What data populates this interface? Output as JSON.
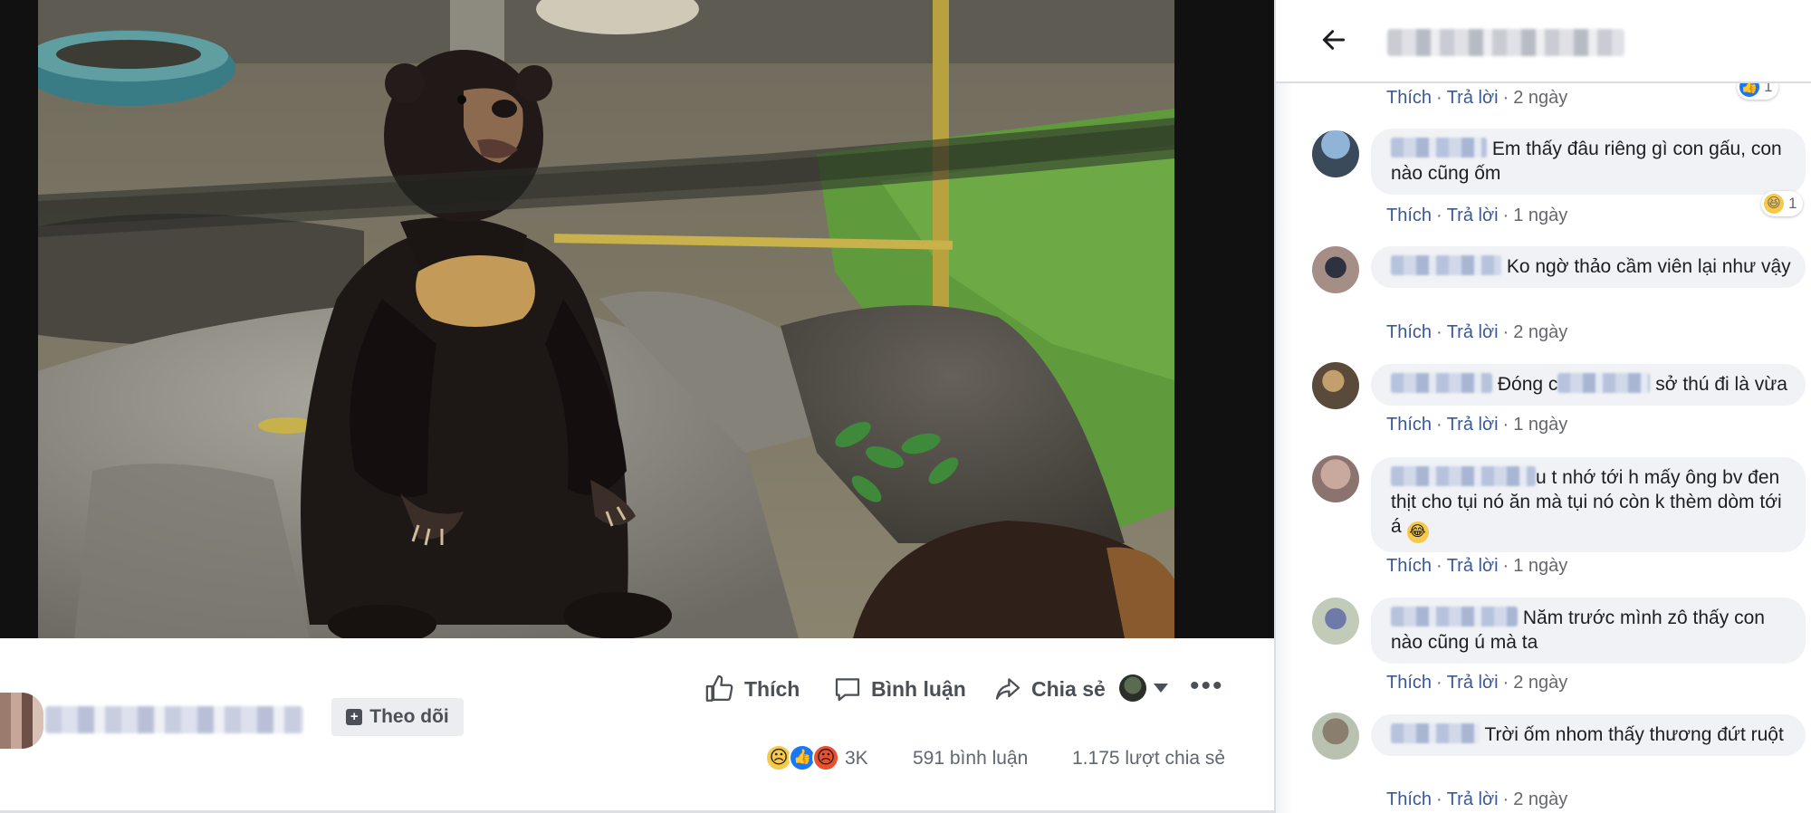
{
  "post": {
    "actions": {
      "like": "Thích",
      "comment": "Bình luận",
      "share": "Chia sẻ"
    },
    "follow_label": "Theo dõi",
    "reaction_count": "3K",
    "comment_count": "591 bình luận",
    "share_count": "1.175 lượt chia sẻ",
    "reaction_icons": [
      "sad",
      "like",
      "angry"
    ]
  },
  "panel": {
    "back_icon": "arrow-left-icon"
  },
  "comments": [
    {
      "text": "",
      "like": "Thích",
      "reply": "Trả lời",
      "time": "2 ngày",
      "reaction": {
        "type": "like",
        "count": "1"
      }
    },
    {
      "text": "Em thấy đâu riêng gì con gấu, con nào cũng ốm",
      "like": "Thích",
      "reply": "Trả lời",
      "time": "1 ngày",
      "reaction": {
        "type": "haha",
        "count": "1"
      }
    },
    {
      "text": "Ko ngờ thảo cầm viên lại như vậy",
      "like": "Thích",
      "reply": "Trả lời",
      "time": "2 ngày"
    },
    {
      "text_a": "Đóng c",
      "text_b": "sở thú đi là vừa",
      "like": "Thích",
      "reply": "Trả lời",
      "time": "1 ngày"
    },
    {
      "text_a": "u t nhớ tới h mấy ông bv",
      "text_b": "đen thịt cho tụi nó ăn mà tụi nó còn k thèm dòm tới á",
      "like": "Thích",
      "reply": "Trả lời",
      "time": "1 ngày"
    },
    {
      "text": "Năm trước mình zô thấy con nào cũng ú mà ta",
      "like": "Thích",
      "reply": "Trả lời",
      "time": "2 ngày"
    },
    {
      "text": "Trời ốm nhom thấy thương đứt ruột",
      "like": "Thích",
      "reply": "Trả lời",
      "time": "2 ngày"
    }
  ]
}
